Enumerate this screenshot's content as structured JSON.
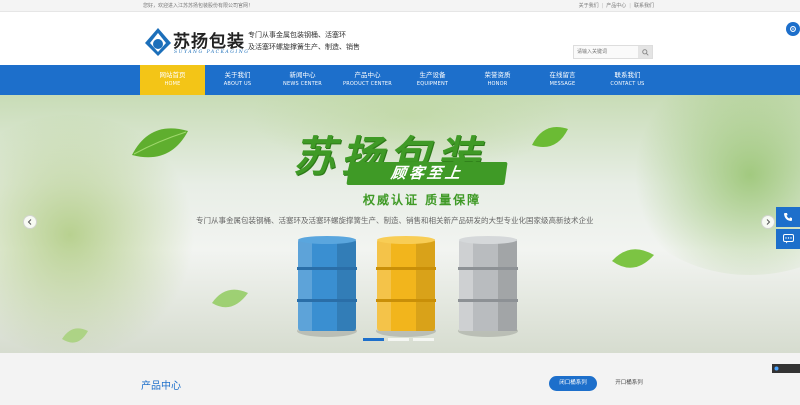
{
  "topbar": {
    "welcome": "您好，欢迎进入江苏苏扬包装股份有限公司官网！",
    "links": [
      "关于我们",
      "产品中心",
      "联系我们"
    ],
    "separator": "|"
  },
  "logo": {
    "name": "苏扬包装",
    "en": "SUYANG PACKAGING"
  },
  "slogan": {
    "line1": "专门从事金属包装钢桶、活塞环",
    "line2": "及活塞环螺旋撑簧生产、制造、销售"
  },
  "search": {
    "placeholder": "请输入关键词"
  },
  "nav": [
    {
      "zh": "网站首页",
      "en": "HOME"
    },
    {
      "zh": "关于我们",
      "en": "ABOUT US"
    },
    {
      "zh": "新闻中心",
      "en": "NEWS CENTER"
    },
    {
      "zh": "产品中心",
      "en": "PRODUCT CENTER"
    },
    {
      "zh": "生产设备",
      "en": "EQUIPMENT"
    },
    {
      "zh": "荣誉资质",
      "en": "HONOR"
    },
    {
      "zh": "在线留言",
      "en": "MESSAGE"
    },
    {
      "zh": "联系我们",
      "en": "CONTACT US"
    }
  ],
  "banner": {
    "title": "苏扬包装",
    "subtitle": "顾客至上",
    "tagline": "权威认证  质量保障",
    "description": "专门从事金属包装钢桶、活塞环及活塞环螺旋撑簧生产、制造、销售和相关新产品研发的大型专业化国家级高新技术企业",
    "barrel_colors": [
      "#3a8fd1",
      "#f2b51c",
      "#b9bcbf"
    ]
  },
  "section": {
    "title": "产品中心",
    "tabs": [
      "闭口桶系列",
      "开口桶系列"
    ]
  },
  "colors": {
    "brand": "#1d6fcb",
    "active_nav": "#f3c517",
    "green": "#3f9a26"
  }
}
